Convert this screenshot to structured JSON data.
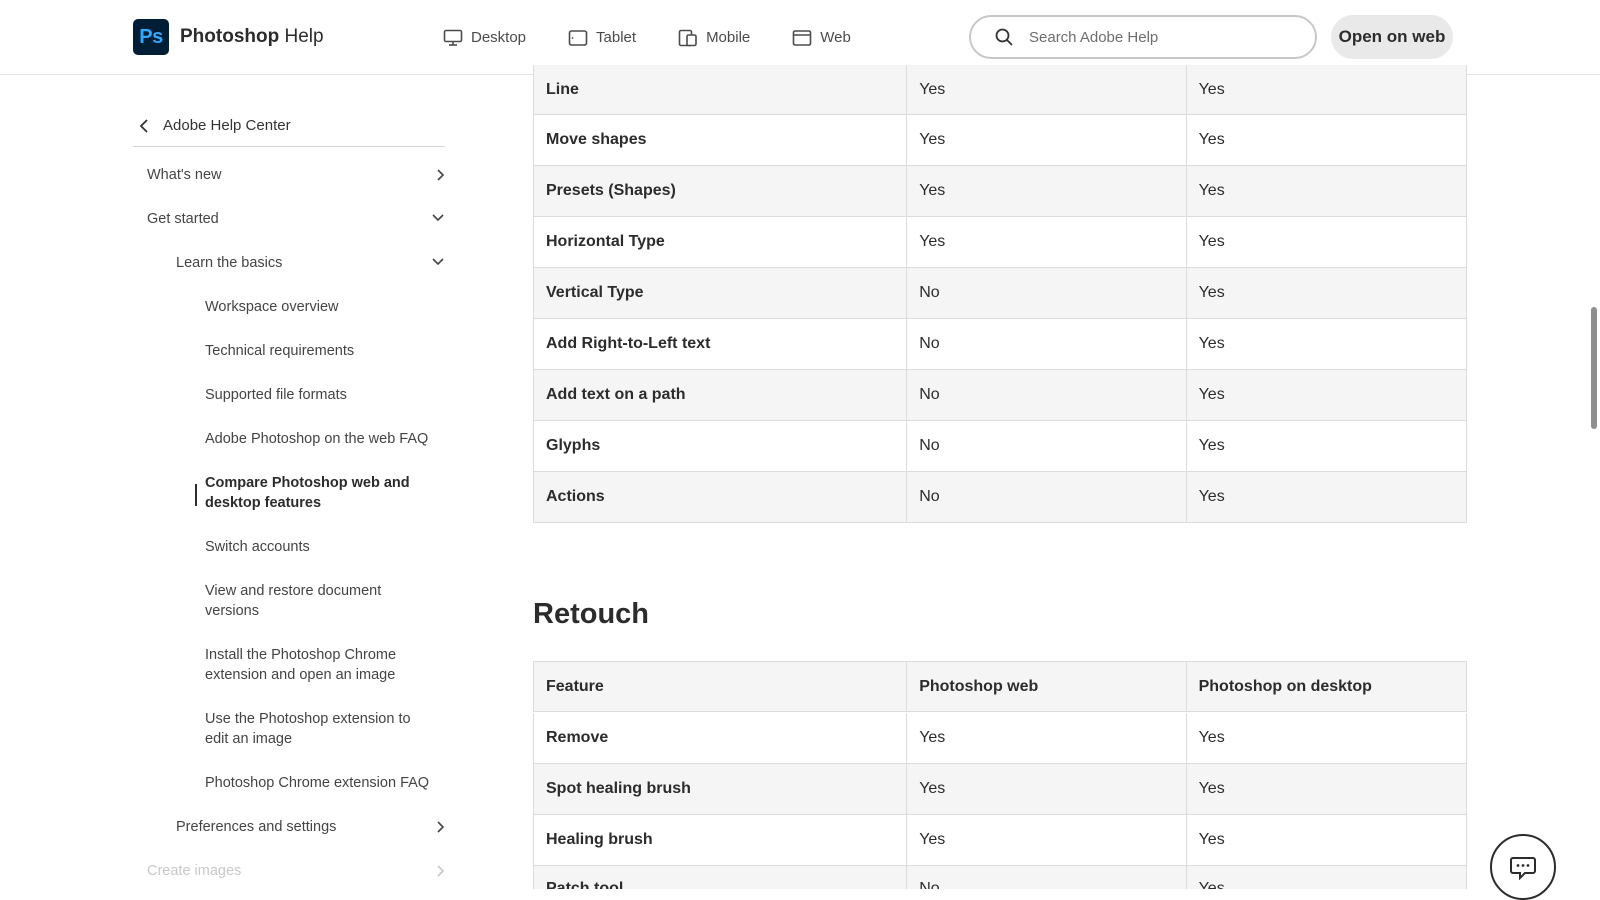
{
  "header": {
    "logo_text": "Ps",
    "title_bold": "Photoshop",
    "title_light": "Help",
    "nav": [
      {
        "label": "Desktop",
        "icon": "desktop-icon"
      },
      {
        "label": "Tablet",
        "icon": "tablet-icon"
      },
      {
        "label": "Mobile",
        "icon": "mobile-icon"
      },
      {
        "label": "Web",
        "icon": "web-icon",
        "active": true
      }
    ],
    "search_placeholder": "Search Adobe Help",
    "open_web_label": "Open on web"
  },
  "sidebar": {
    "back_label": "Adobe Help Center",
    "items": [
      {
        "label": "What's new",
        "chevron": "right"
      },
      {
        "label": "Get started",
        "chevron": "down"
      },
      {
        "label": "Learn the basics",
        "chevron": "down"
      },
      {
        "label": "Workspace overview"
      },
      {
        "label": "Technical requirements"
      },
      {
        "label": "Supported file formats"
      },
      {
        "label": "Adobe Photoshop on the web FAQ"
      },
      {
        "label_line1": "Compare Photoshop web and",
        "label_line2": "desktop features",
        "current": true
      },
      {
        "label": "Switch accounts"
      },
      {
        "label_line1": "View and restore document",
        "label_line2": "versions"
      },
      {
        "label_line1": "Install the Photoshop Chrome",
        "label_line2": "extension and open an image"
      },
      {
        "label_line1": "Use the Photoshop extension to",
        "label_line2": "edit an image"
      },
      {
        "label": "Photoshop Chrome extension FAQ"
      },
      {
        "label": "Preferences and settings",
        "chevron": "right"
      },
      {
        "label": "Create images",
        "chevron": "right"
      }
    ]
  },
  "main": {
    "shapes_table": {
      "rows": [
        [
          "Line",
          "Yes",
          "Yes"
        ],
        [
          "Move shapes",
          "Yes",
          "Yes"
        ],
        [
          "Presets (Shapes)",
          "Yes",
          "Yes"
        ],
        [
          "Horizontal Type",
          "Yes",
          "Yes"
        ],
        [
          "Vertical Type",
          "No",
          "Yes"
        ],
        [
          "Add Right-to-Left text",
          "No",
          "Yes"
        ],
        [
          "Add text on a path",
          "No",
          "Yes"
        ],
        [
          "Glyphs",
          "No",
          "Yes"
        ],
        [
          "Actions",
          "No",
          "Yes"
        ]
      ]
    },
    "retouch_title": "Retouch",
    "retouch_table": {
      "headers": [
        "Feature",
        "Photoshop web",
        "Photoshop on desktop"
      ],
      "rows": [
        [
          "Remove",
          "Yes",
          "Yes"
        ],
        [
          "Spot healing brush",
          "Yes",
          "Yes"
        ],
        [
          "Healing brush",
          "Yes",
          "Yes"
        ],
        [
          "Patch tool",
          "No",
          "Yes"
        ]
      ]
    }
  }
}
